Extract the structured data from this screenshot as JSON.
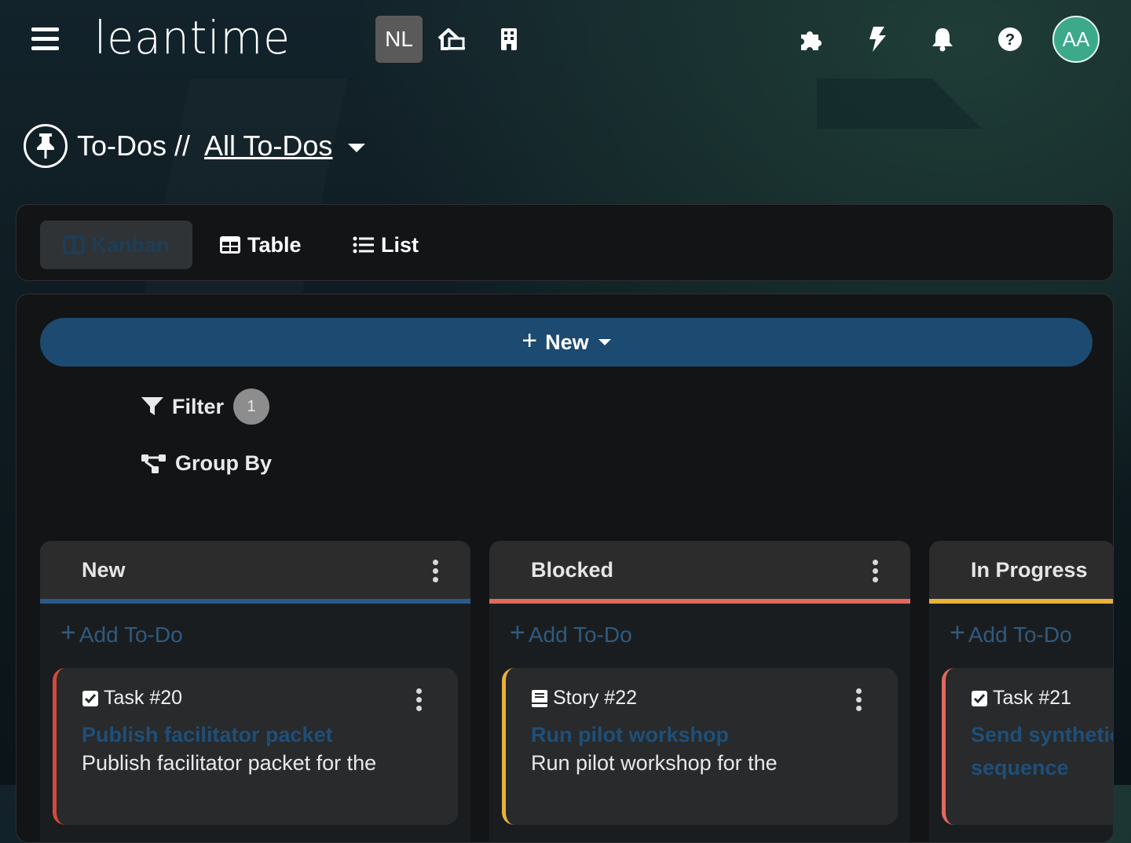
{
  "header": {
    "logo_text": "leantime",
    "project_badge": "NL",
    "avatar_initials": "AA",
    "icons": [
      "menu-icon",
      "home-icon",
      "building-icon",
      "puzzle-icon",
      "bolt-icon",
      "bell-icon",
      "help-icon"
    ]
  },
  "page": {
    "title_prefix": "To-Dos //",
    "title_link": "All To-Dos"
  },
  "views": {
    "kanban": "Kanban",
    "table": "Table",
    "list": "List"
  },
  "toolbar": {
    "new_label": "New",
    "filter_label": "Filter",
    "filter_count": "1",
    "group_label": "Group By"
  },
  "columns": [
    {
      "title": "New",
      "color": "#2a5a8c",
      "add_label": "Add To-Do",
      "card": {
        "type": "Task #20",
        "title": "Publish facilitator packet",
        "desc": "Publish facilitator packet for the",
        "border": "#d24a3c"
      }
    },
    {
      "title": "Blocked",
      "color": "#e06a5c",
      "add_label": "Add To-Do",
      "card": {
        "type": "Story #22",
        "title": "Run pilot workshop",
        "desc": "Run pilot workshop for the",
        "border": "#e8b23a"
      }
    },
    {
      "title": "In Progress",
      "color": "#e8b23a",
      "add_label": "Add To-Do",
      "card": {
        "type": "Task #21",
        "title": "Send synthetic",
        "title2": "sequence",
        "border": "#e06a5c"
      }
    }
  ],
  "colors": {
    "accent": "#1c4a70",
    "link": "#1e4f7a",
    "avatar": "#3ba98a"
  }
}
